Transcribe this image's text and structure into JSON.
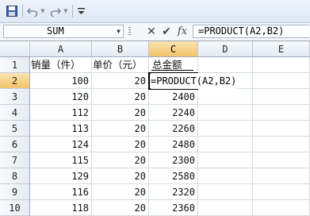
{
  "quick_access": {
    "icons": [
      "save-icon",
      "undo-icon",
      "redo-icon",
      "customize-icon"
    ]
  },
  "formula_bar": {
    "name_box": "SUM",
    "cancel_glyph": "✕",
    "enter_glyph": "✔",
    "fx_glyph": "fx",
    "formula": "=PRODUCT(A2,B2)"
  },
  "columns": [
    "A",
    "B",
    "C",
    "D",
    "E"
  ],
  "rows": [
    "1",
    "2",
    "3",
    "4",
    "5",
    "6",
    "7",
    "8",
    "9",
    "10"
  ],
  "header_row": {
    "a": "销量（件）",
    "b": "单价（元）",
    "c": "总金额"
  },
  "data_rows": [
    {
      "a": "100",
      "b": "20",
      "c": ""
    },
    {
      "a": "120",
      "b": "20",
      "c": "2400"
    },
    {
      "a": "112",
      "b": "20",
      "c": "2240"
    },
    {
      "a": "113",
      "b": "20",
      "c": "2260"
    },
    {
      "a": "124",
      "b": "20",
      "c": "2480"
    },
    {
      "a": "115",
      "b": "20",
      "c": "2300"
    },
    {
      "a": "129",
      "b": "20",
      "c": "2580"
    },
    {
      "a": "116",
      "b": "20",
      "c": "2320"
    },
    {
      "a": "118",
      "b": "20",
      "c": "2360"
    }
  ],
  "editing_cell": {
    "ref": "C2",
    "text": "=PRODUCT(A2,B2)"
  },
  "colors": {
    "active_header": "#f2c46a",
    "grid_line": "#d4dbe5",
    "toolbar_bg": "#dfe8f4"
  }
}
